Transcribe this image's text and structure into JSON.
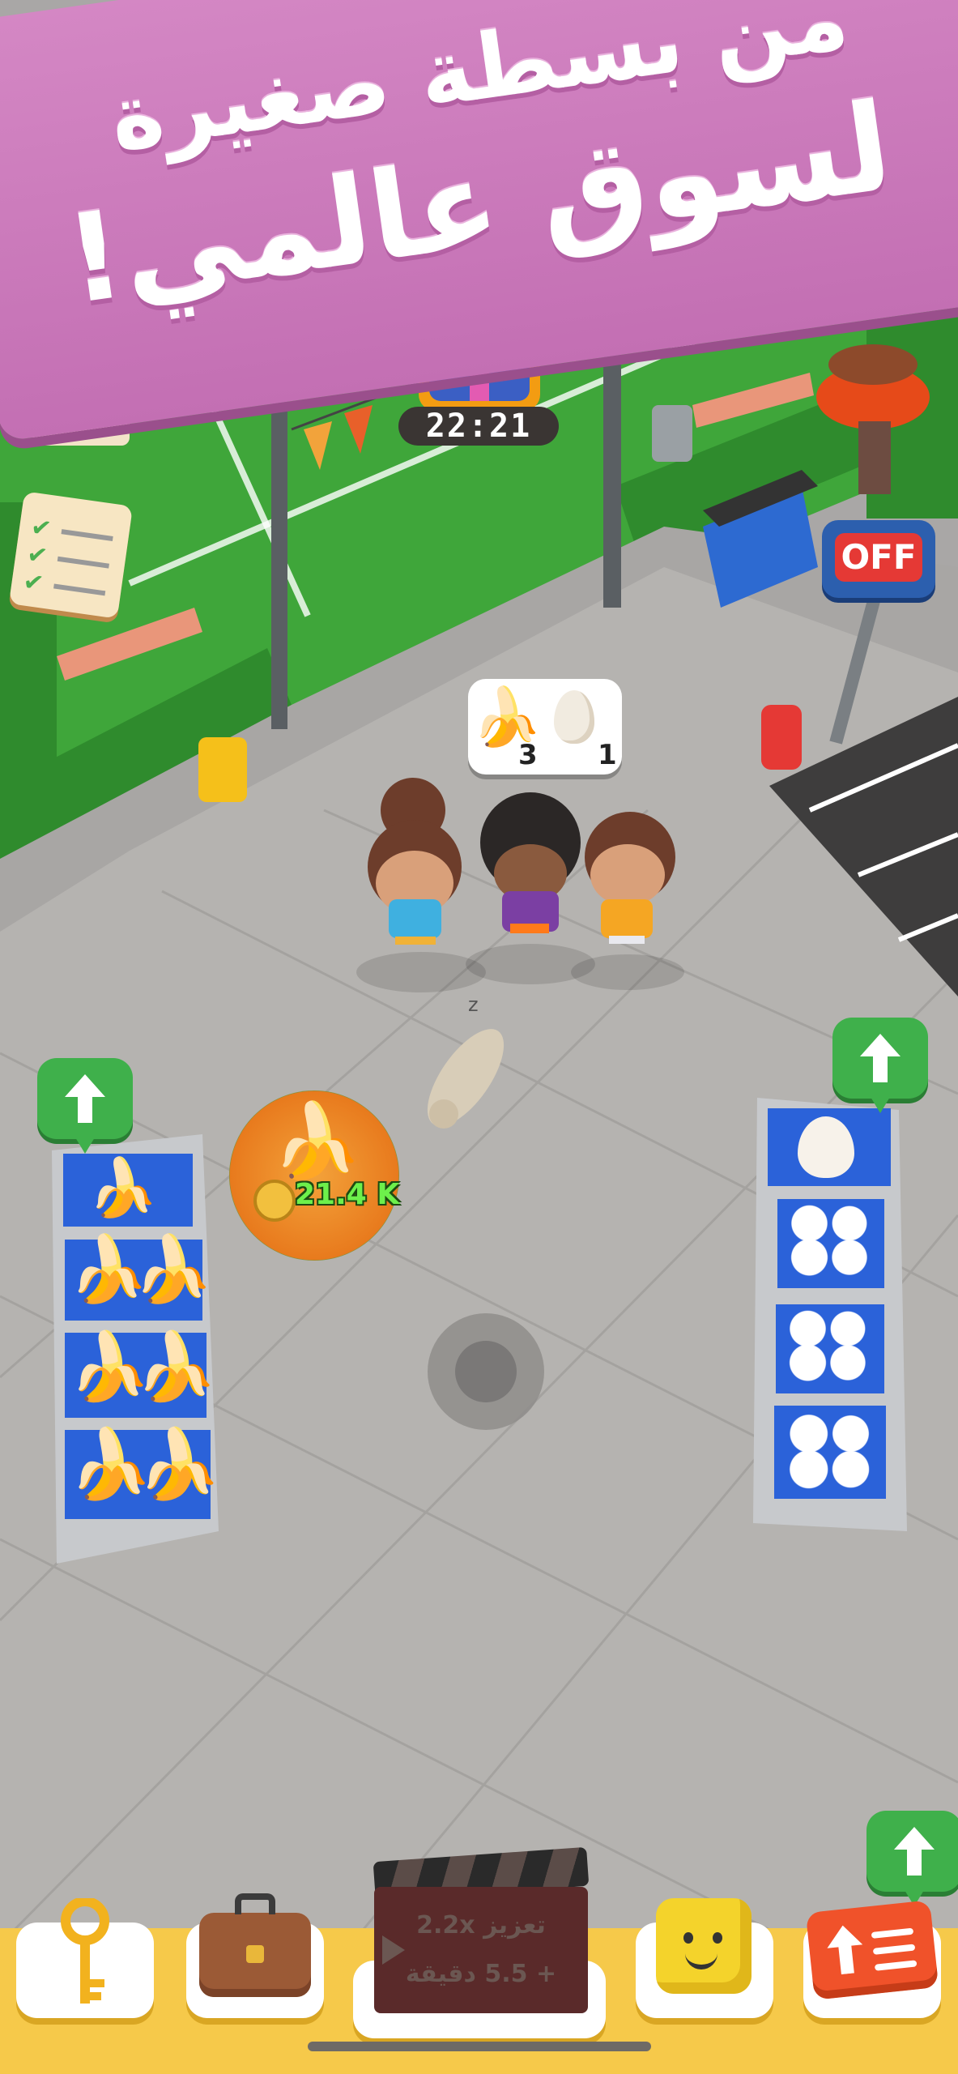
{
  "banner": {
    "line1": "من بسطة صغيرة",
    "line2": "لسوق عالمي!"
  },
  "gift_timer": "22:21",
  "radio_label": "OFF",
  "order": {
    "banana_count": "3",
    "egg_count": "1"
  },
  "coin_stack": {
    "amount": "21.4 K"
  },
  "ad_boost": {
    "line1": "تعزيز 2.2x",
    "line2": "+ 5.5 دقيقة"
  },
  "icons": {
    "checklist": "checklist-icon",
    "key": "key-icon",
    "briefcase": "briefcase-icon",
    "character": "yellow-cube-face-icon",
    "upgrade": "upgrade-ticket-icon"
  }
}
